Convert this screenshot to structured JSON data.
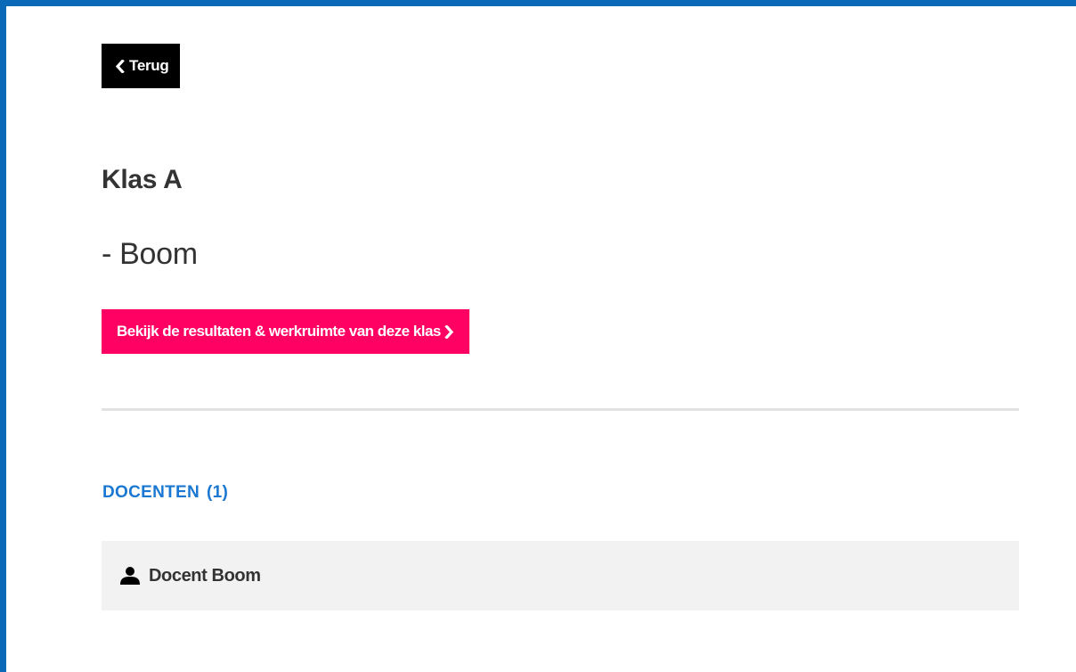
{
  "header": {
    "back_label": "Terug",
    "back_icon": "chevron-left-icon"
  },
  "class": {
    "title": "Klas A",
    "subtitle": "- Boom",
    "results_button_label": "Bekijk de resultaten & werkruimte van deze klas",
    "results_button_icon": "chevron-right-icon"
  },
  "teachers": {
    "heading": "DOCENTEN",
    "count": "(1)",
    "items": [
      {
        "name": "Docent Boom",
        "icon": "user-icon"
      }
    ]
  },
  "colors": {
    "frame": "#0b6ab8",
    "back_button_bg": "#000000",
    "accent_pink": "#ff0063",
    "section_heading": "#1a78d2",
    "row_bg": "#f2f2f2",
    "divider": "#e2e2e2"
  }
}
